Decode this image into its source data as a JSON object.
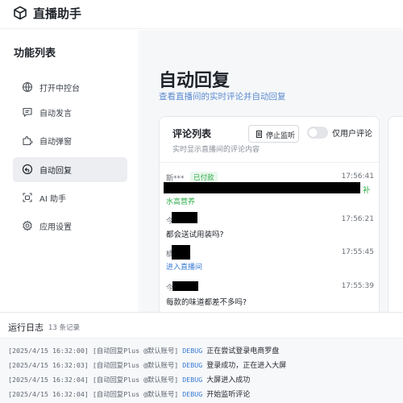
{
  "app": {
    "title": "直播助手",
    "logo_icon": "cube-icon"
  },
  "sidebar": {
    "title": "功能列表",
    "items": [
      {
        "label": "打开中控台",
        "icon": "globe-icon",
        "active": false
      },
      {
        "label": "自动发言",
        "icon": "message-icon",
        "active": false
      },
      {
        "label": "自动弹窗",
        "icon": "puzzle-icon",
        "active": false
      },
      {
        "label": "自动回复",
        "icon": "reply-icon",
        "active": true
      },
      {
        "label": "AI 助手",
        "icon": "robot-icon",
        "active": false
      },
      {
        "label": "应用设置",
        "icon": "gear-icon",
        "active": false
      }
    ]
  },
  "main": {
    "title": "自动回复",
    "subtitle": "查看直播间的实时评论并自动回复",
    "comment_card": {
      "title": "评论列表",
      "subtitle": "实时显示直播间的评论内容",
      "stop_button": "停止监听",
      "toggle_label": "仅用户评论",
      "toggle_on": false,
      "comments": [
        {
          "user": "斯***",
          "badge": "已付款",
          "time": "17:56:41",
          "text": "",
          "tag": "水高营养",
          "tag_color": "#2bad48",
          "trailing": "补"
        },
        {
          "user": "今",
          "badge": "",
          "time": "17:56:21",
          "text": "都会送试用装吗?",
          "tag": "",
          "tag_color": "",
          "trailing": ""
        },
        {
          "user": "橘",
          "badge": "",
          "time": "17:55:45",
          "text": "",
          "tag": "进入直播间",
          "tag_color": "#3a7bd5",
          "trailing": ""
        },
        {
          "user": "今",
          "badge": "",
          "time": "17:55:39",
          "text": "每款的味道都差不多吗?",
          "tag": "",
          "tag_color": "",
          "trailing": ""
        }
      ]
    }
  },
  "log": {
    "title": "运行日志",
    "count": "13 条记录",
    "lines": [
      {
        "time": "[2025/4/15 16:32:00]",
        "source": "[自动回复Plus @默认账号]",
        "level": "DEBUG",
        "message": "正在尝试登录电商罗盘"
      },
      {
        "time": "[2025/4/15 16:32:03]",
        "source": "[自动回复Plus @默认账号]",
        "level": "DEBUG",
        "message": "登录成功，正在进入大屏"
      },
      {
        "time": "[2025/4/15 16:32:04]",
        "source": "[自动回复Plus @默认账号]",
        "level": "DEBUG",
        "message": "大屏进入成功"
      },
      {
        "time": "[2025/4/15 16:32:04]",
        "source": "[自动回复Plus @默认账号]",
        "level": "DEBUG",
        "message": "开始监听评论"
      }
    ]
  },
  "colors": {
    "accent_blue": "#3a7bd5",
    "success_green": "#2bad48",
    "active_bg": "#eceef1"
  }
}
